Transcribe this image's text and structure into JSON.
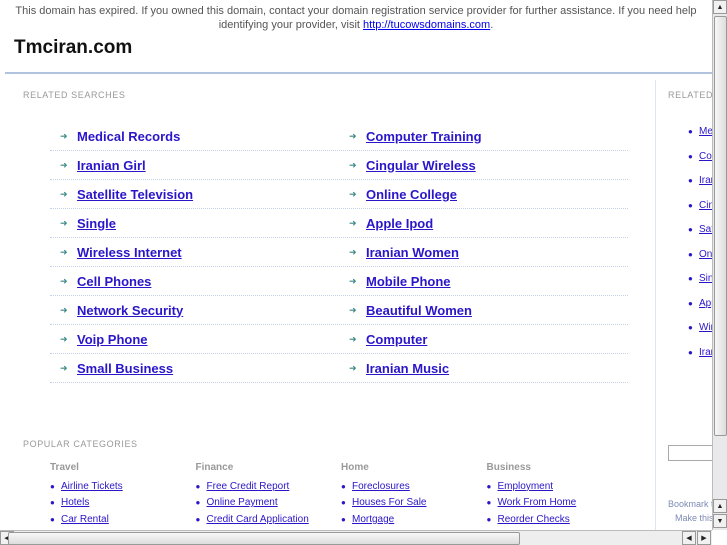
{
  "notice": {
    "text": "This domain has expired. If you owned this domain, contact your domain registration service provider for further assistance. If you need help identifying your provider, visit ",
    "link": "http://tucowsdomains.com",
    "suffix": "."
  },
  "site_title": "Tmciran.com",
  "related_searches": {
    "label": "RELATED SEARCHES",
    "rows": [
      [
        "Medical Records",
        "Computer Training"
      ],
      [
        "Iranian Girl",
        "Cingular Wireless"
      ],
      [
        "Satellite Television",
        "Online College"
      ],
      [
        "Single",
        "Apple Ipod"
      ],
      [
        "Wireless Internet",
        "Iranian Women"
      ],
      [
        "Cell Phones",
        "Mobile Phone"
      ],
      [
        "Network Security",
        "Beautiful Women"
      ],
      [
        "Voip Phone",
        "Computer"
      ],
      [
        "Small Business",
        "Iranian Music"
      ]
    ]
  },
  "popular_categories": {
    "label": "POPULAR CATEGORIES",
    "columns": [
      {
        "heading": "Travel",
        "items": [
          "Airline Tickets",
          "Hotels",
          "Car Rental"
        ]
      },
      {
        "heading": "Finance",
        "items": [
          "Free Credit Report",
          "Online Payment",
          "Credit Card Application"
        ]
      },
      {
        "heading": "Home",
        "items": [
          "Foreclosures",
          "Houses For Sale",
          "Mortgage"
        ]
      },
      {
        "heading": "Business",
        "items": [
          "Employment",
          "Work From Home",
          "Reorder Checks"
        ]
      }
    ]
  },
  "sidebar": {
    "label": "RELATED",
    "items": [
      "Medical Records",
      "Computer Training",
      "Iranian Girl",
      "Cingular Wireless",
      "Satellite Television",
      "Online College",
      "Single",
      "Apple Ipod",
      "Wireless Internet",
      "Iranian Women"
    ],
    "bookmark": "Bookmark this page",
    "make": "Make this your homepage"
  },
  "colors": {
    "link": "#2a16c9",
    "arrow": "#3a8a86",
    "divider": "#b2c3e0"
  }
}
